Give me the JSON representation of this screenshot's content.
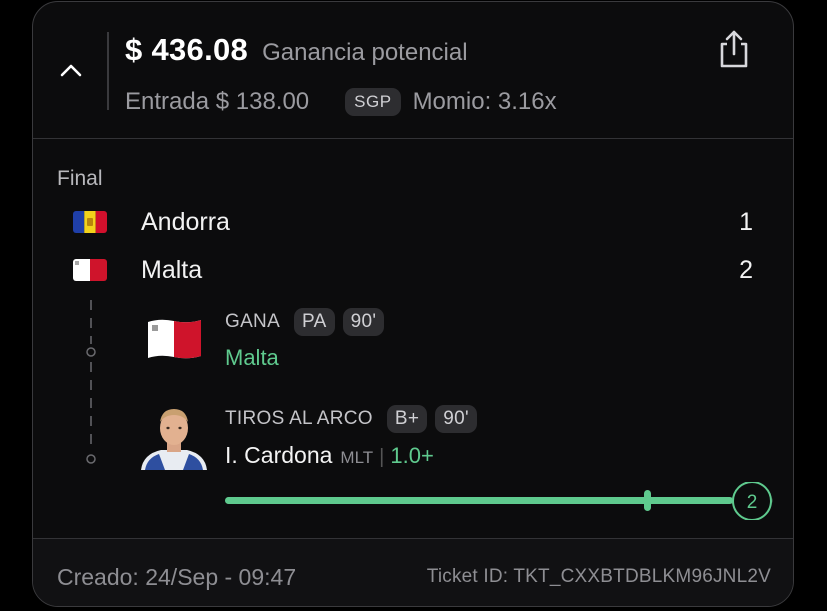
{
  "header": {
    "amount": "$ 436.08",
    "payout_label": "Ganancia potencial",
    "entry": "Entrada $ 138.00",
    "badge": "SGP",
    "odds": "Momio: 3.16x"
  },
  "match": {
    "status": "Final",
    "teams": [
      {
        "name": "Andorra",
        "score": "1",
        "flag_icon": "andorra-flag-icon"
      },
      {
        "name": "Malta",
        "score": "2",
        "flag_icon": "malta-flag-icon"
      }
    ]
  },
  "legs": [
    {
      "type": "GANA",
      "chips": [
        "PA",
        "90'"
      ],
      "selection": "Malta",
      "thumb_icon": "malta-flag-icon"
    },
    {
      "type": "TIROS AL ARCO",
      "chips": [
        "B+",
        "90'"
      ],
      "player": "I. Cardona",
      "team": "MLT",
      "separator": "|",
      "line": "1.0+",
      "thumb_icon": "player-photo",
      "progress_value": "2",
      "progress_fraction": 1.0,
      "progress_marker_fraction": 0.83
    }
  ],
  "footer": {
    "created": "Creado: 24/Sep - 09:47",
    "ticket": "Ticket ID: TKT_CXXBTDBLKM96JNL2V"
  },
  "colors": {
    "accent_green": "#5fca8e",
    "background": "#000000",
    "card": "#0c0c0d",
    "chip": "#2d2d30"
  }
}
